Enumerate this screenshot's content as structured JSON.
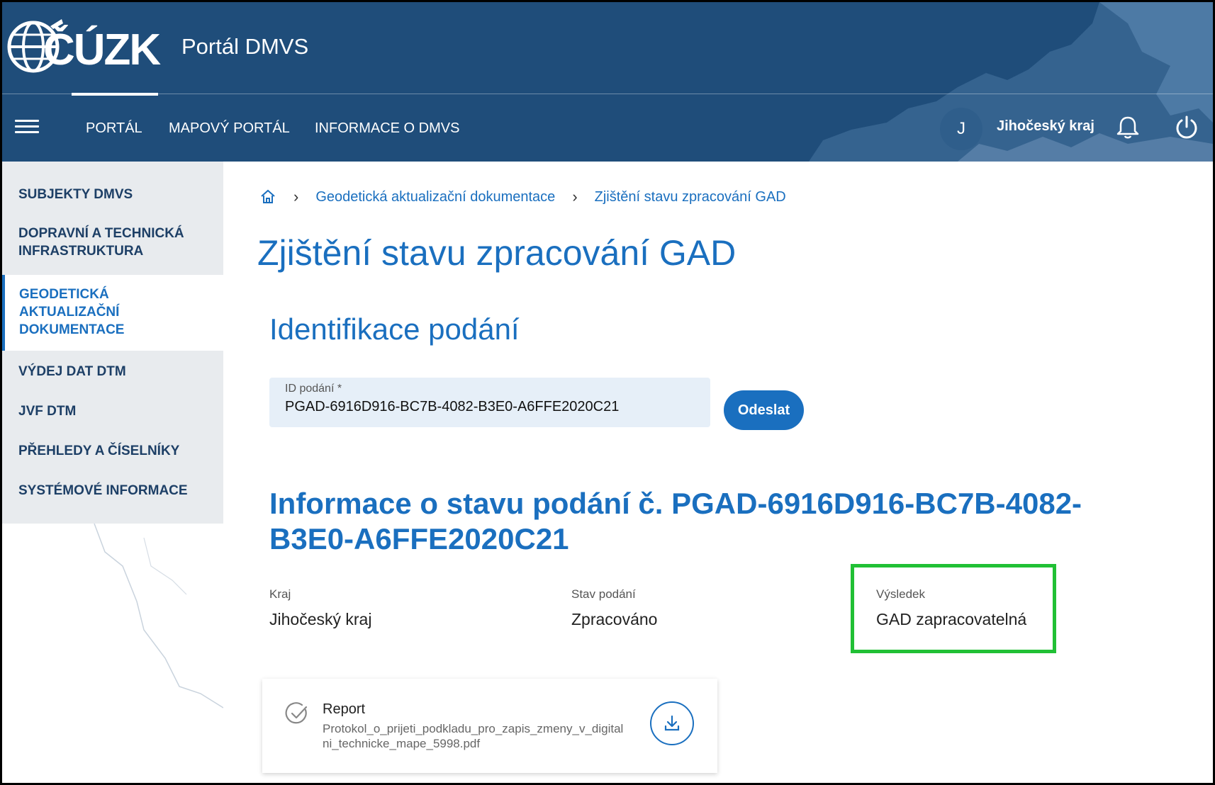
{
  "header": {
    "logo_text": "ČÚZK",
    "portal_title": "Portál DMVS",
    "nav": [
      "PORTÁL",
      "MAPOVÝ PORTÁL",
      "INFORMACE O DMVS"
    ],
    "user_initial": "J",
    "region": "Jihočeský kraj"
  },
  "sidebar": {
    "items": [
      "SUBJEKTY DMVS",
      "DOPRAVNÍ A TECHNICKÁ INFRASTRUKTURA",
      "GEODETICKÁ AKTUALIZAČNÍ DOKUMENTACE",
      "VÝDEJ DAT DTM",
      "JVF DTM",
      "PŘEHLEDY A ČÍSELNÍKY",
      "SYSTÉMOVÉ INFORMACE"
    ],
    "active_index": 2
  },
  "breadcrumb": [
    "Geodetická aktualizační dokumentace",
    "Zjištění stavu zpracování GAD"
  ],
  "page_title": "Zjištění stavu zpracování GAD",
  "identification": {
    "title": "Identifikace podání",
    "field_label": "ID podání *",
    "field_value": "PGAD-6916D916-BC7B-4082-B3E0-A6FFE2020C21",
    "submit_label": "Odeslat"
  },
  "status": {
    "title": "Informace o stavu podání č. PGAD-6916D916-BC7B-4082-B3E0-A6FFE2020C21",
    "kraj_label": "Kraj",
    "kraj_value": "Jihočeský kraj",
    "stav_label": "Stav podání",
    "stav_value": "Zpracováno",
    "vysledek_label": "Výsledek",
    "vysledek_value": "GAD zapracovatelná"
  },
  "report": {
    "title": "Report",
    "filename": "Protokol_o_prijeti_podkladu_pro_zapis_zmeny_v_digitalni_technicke_mape_5998.pdf"
  },
  "colors": {
    "header_bg": "#1f4d7a",
    "accent": "#1a6fbf",
    "highlight": "#21c035",
    "sidebar_bg": "#e8ebee"
  }
}
